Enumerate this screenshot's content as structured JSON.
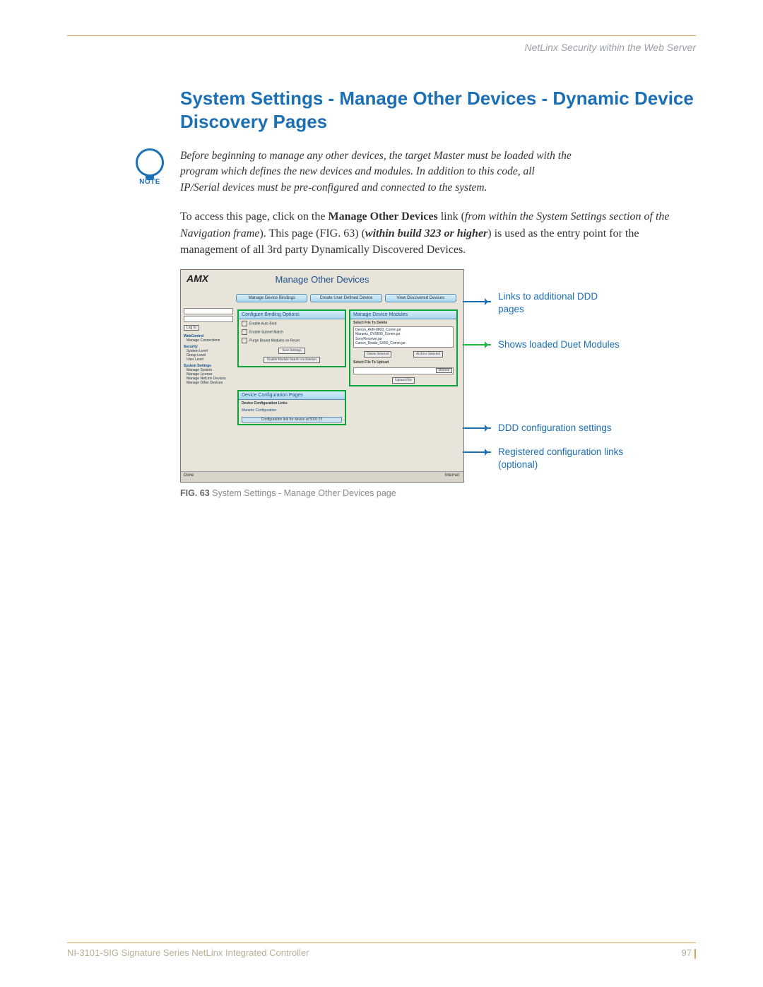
{
  "header": {
    "section": "NetLinx Security within the Web Server"
  },
  "title": "System Settings - Manage Other Devices - Dynamic Device Discovery Pages",
  "note": {
    "label": "NOTE",
    "text": "Before beginning to manage any other devices, the target Master must be loaded with the program which defines the new devices and modules. In addition to this code, all IP/Serial devices must be pre-configured and connected to the system."
  },
  "para": {
    "pre": "To access this page, click on the ",
    "bold1": "Manage Other Devices",
    "mid1": " link (",
    "ital1": "from within the System Settings section of the Navigation frame",
    "mid2": "). This page (FIG. 63) (",
    "bolditalic": "within build 323 or higher",
    "mid3": ") is used as the entry point for the management of all 3rd party Dynamically Discovered Devices."
  },
  "screenshot": {
    "logo": "AMX",
    "title": "Manage Other Devices",
    "tabs": [
      "Manage Device Bindings",
      "Create User Defined Device",
      "View Discovered Devices"
    ],
    "left": {
      "login_btn": "Log In",
      "webcontrol": "WebControl",
      "webcontrol_sub": "Manage Connections",
      "security": "Security",
      "security_subs": [
        "System Level",
        "Group Level",
        "User Level"
      ],
      "system": "System Settings",
      "system_subs": [
        "Manage System",
        "Manage License",
        "Manage NetLinx Devices",
        "Manage Other Devices"
      ]
    },
    "panel1": {
      "hdr": "Configure Binding Options",
      "opt1": "Enable Auto Bind",
      "opt2": "Enable Subnet Match",
      "opt3": "Purge Bound Modules on Reset",
      "save": "Save Settings",
      "enable_search": "Enable Module Search via Internet"
    },
    "panel2": {
      "hdr": "Manage Device Modules",
      "lbl1": "Select File To Delete",
      "list": [
        "Denon_AVR-8803_Comm.jar",
        "Marantz_DV9500_Comm.jar",
        "SonyReceiver.jar",
        "Canon_Realis_SX50_Comm.jar"
      ],
      "del": "Delete Selected",
      "arc": "Archive Selected",
      "lbl2": "Select File To Upload",
      "browse": "Browse",
      "upload": "Upload File"
    },
    "panel3": {
      "hdr": "Device Configuration Pages",
      "link_hdr": "Device Configuration Links",
      "link1": "Marantz Configuration",
      "cfg": "Configuration link for device at 5001:23"
    },
    "status": {
      "done": "Done",
      "net": "Internet"
    }
  },
  "annotations": {
    "a1": "Links to additional DDD pages",
    "a2": "Shows loaded Duet Modules",
    "a3": "DDD configuration settings",
    "a4": "Registered configuration links (optional)"
  },
  "caption": {
    "fig": "FIG. 63",
    "text": "  System Settings - Manage Other Devices page"
  },
  "footer": {
    "doc": "NI-3101-SIG Signature Series NetLinx Integrated Controller",
    "page": "97"
  }
}
